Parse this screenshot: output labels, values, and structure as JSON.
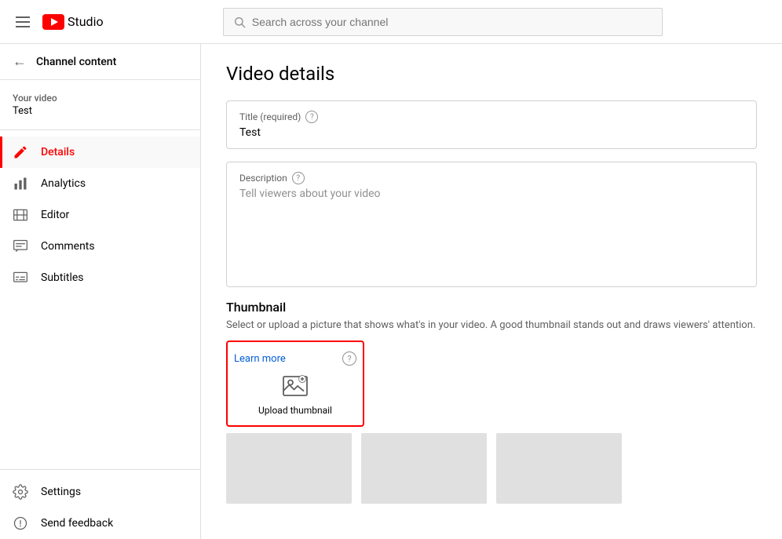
{
  "topbar": {
    "logo_text": "Studio",
    "search_placeholder": "Search across your channel"
  },
  "sidebar": {
    "channel_content_label": "Channel content",
    "your_video_label": "Your video",
    "your_video_title": "Test",
    "items": [
      {
        "id": "details",
        "label": "Details",
        "icon": "pencil-icon",
        "active": true
      },
      {
        "id": "analytics",
        "label": "Analytics",
        "icon": "analytics-icon",
        "active": false
      },
      {
        "id": "editor",
        "label": "Editor",
        "icon": "editor-icon",
        "active": false
      },
      {
        "id": "comments",
        "label": "Comments",
        "icon": "comments-icon",
        "active": false
      },
      {
        "id": "subtitles",
        "label": "Subtitles",
        "icon": "subtitles-icon",
        "active": false
      }
    ],
    "bottom_items": [
      {
        "id": "settings",
        "label": "Settings",
        "icon": "settings-icon"
      },
      {
        "id": "send-feedback",
        "label": "Send feedback",
        "icon": "feedback-icon"
      }
    ]
  },
  "main": {
    "page_title": "Video details",
    "title_field": {
      "label": "Title (required)",
      "value": "Test"
    },
    "description_field": {
      "label": "Description",
      "placeholder": "Tell viewers about your video"
    },
    "thumbnail": {
      "section_title": "Thumbnail",
      "section_desc": "Select or upload a picture that shows what's in your video. A good thumbnail stands out and draws viewers' attention.",
      "learn_more": "Learn more",
      "upload_label": "Upload thumbnail"
    }
  }
}
